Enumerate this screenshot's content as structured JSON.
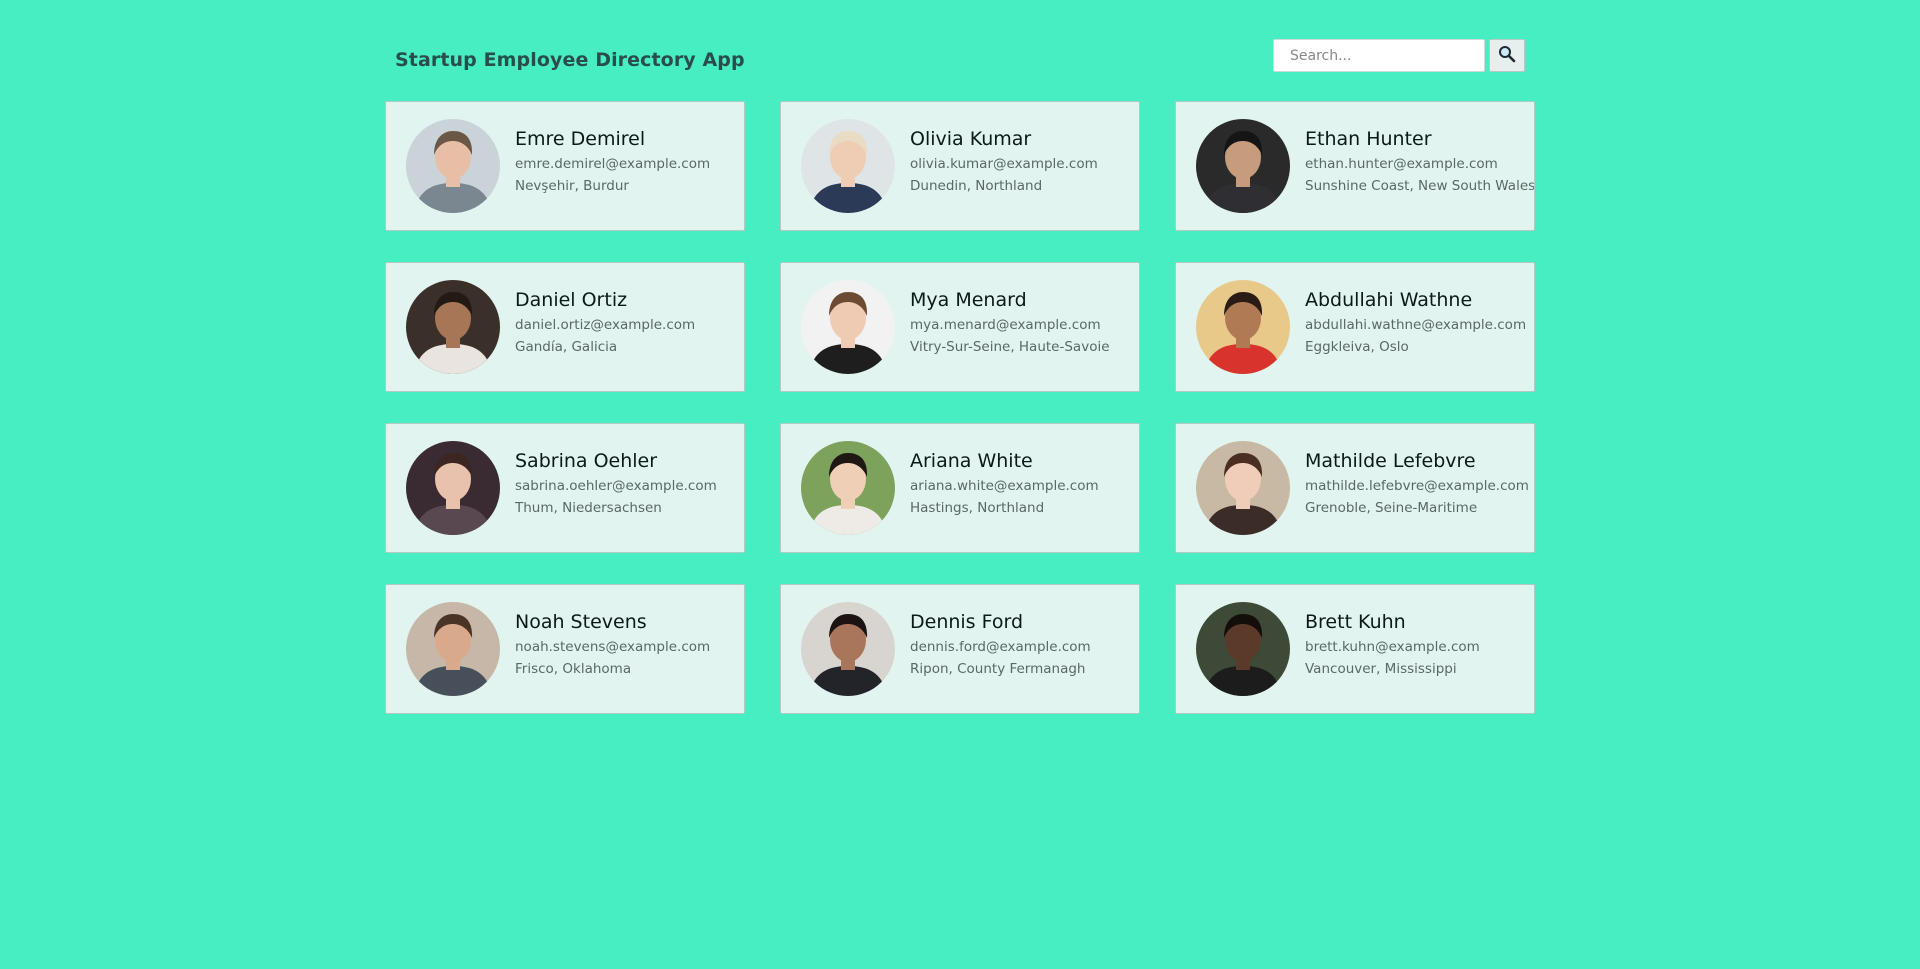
{
  "app": {
    "title": "Startup Employee Directory App"
  },
  "search": {
    "placeholder": "Search...",
    "value": "",
    "button_icon": "magnifier-icon"
  },
  "colors": {
    "background": "#46eec2",
    "card": "#e1f4f0",
    "card_border": "#b4cac5"
  },
  "employees": [
    {
      "name": "Emre Demirel",
      "email": "emre.demirel@example.com",
      "location": "Nevşehir, Burdur",
      "avatar": {
        "bg": "#c9d3d8",
        "skin": "#e6bfa6",
        "hair": "#6b5746",
        "shirt": "#7a8790"
      }
    },
    {
      "name": "Olivia Kumar",
      "email": "olivia.kumar@example.com",
      "location": "Dunedin, Northland",
      "avatar": {
        "bg": "#dfe4e6",
        "skin": "#efcdb5",
        "hair": "#e8dcc4",
        "shirt": "#2b3a57"
      }
    },
    {
      "name": "Ethan Hunter",
      "email": "ethan.hunter@example.com",
      "location": "Sunshine Coast, New South Wales",
      "avatar": {
        "bg": "#2a2a2a",
        "skin": "#c79c7c",
        "hair": "#151515",
        "shirt": "#2f2f33"
      }
    },
    {
      "name": "Daniel Ortiz",
      "email": "daniel.ortiz@example.com",
      "location": "Gandía, Galicia",
      "avatar": {
        "bg": "#3b2f2a",
        "skin": "#a77657",
        "hair": "#241a15",
        "shirt": "#e9e4df"
      }
    },
    {
      "name": "Mya Menard",
      "email": "mya.menard@example.com",
      "location": "Vitry-Sur-Seine, Haute-Savoie",
      "avatar": {
        "bg": "#f2f2f2",
        "skin": "#f0cbb3",
        "hair": "#6d4a33",
        "shirt": "#1e1e1e"
      }
    },
    {
      "name": "Abdullahi Wathne",
      "email": "abdullahi.wathne@example.com",
      "location": "Eggkleiva, Oslo",
      "avatar": {
        "bg": "#e8c98a",
        "skin": "#b07a55",
        "hair": "#2a1c14",
        "shirt": "#d8342d"
      }
    },
    {
      "name": "Sabrina Oehler",
      "email": "sabrina.oehler@example.com",
      "location": "Thum, Niedersachsen",
      "avatar": {
        "bg": "#3a2b33",
        "skin": "#e9c2ad",
        "hair": "#3d2621",
        "shirt": "#5a4850"
      }
    },
    {
      "name": "Ariana White",
      "email": "ariana.white@example.com",
      "location": "Hastings, Northland",
      "avatar": {
        "bg": "#7da25c",
        "skin": "#f0cfb7",
        "hair": "#1e1714",
        "shirt": "#eeeae6"
      }
    },
    {
      "name": "Mathilde Lefebvre",
      "email": "mathilde.lefebvre@example.com",
      "location": "Grenoble, Seine-Maritime",
      "avatar": {
        "bg": "#c8b9a4",
        "skin": "#f0cdb8",
        "hair": "#4a2e22",
        "shirt": "#3c2c28"
      }
    },
    {
      "name": "Noah Stevens",
      "email": "noah.stevens@example.com",
      "location": "Frisco, Oklahoma",
      "avatar": {
        "bg": "#c6b7a8",
        "skin": "#d9a98b",
        "hair": "#4a3426",
        "shirt": "#47505a"
      }
    },
    {
      "name": "Dennis Ford",
      "email": "dennis.ford@example.com",
      "location": "Ripon, County Fermanagh",
      "avatar": {
        "bg": "#d8d4d0",
        "skin": "#a9765b",
        "hair": "#1b1412",
        "shirt": "#22242a"
      }
    },
    {
      "name": "Brett Kuhn",
      "email": "brett.kuhn@example.com",
      "location": "Vancouver, Mississippi",
      "avatar": {
        "bg": "#3d4a38",
        "skin": "#5b3a2a",
        "hair": "#140e0b",
        "shirt": "#1c1c1c"
      }
    }
  ]
}
